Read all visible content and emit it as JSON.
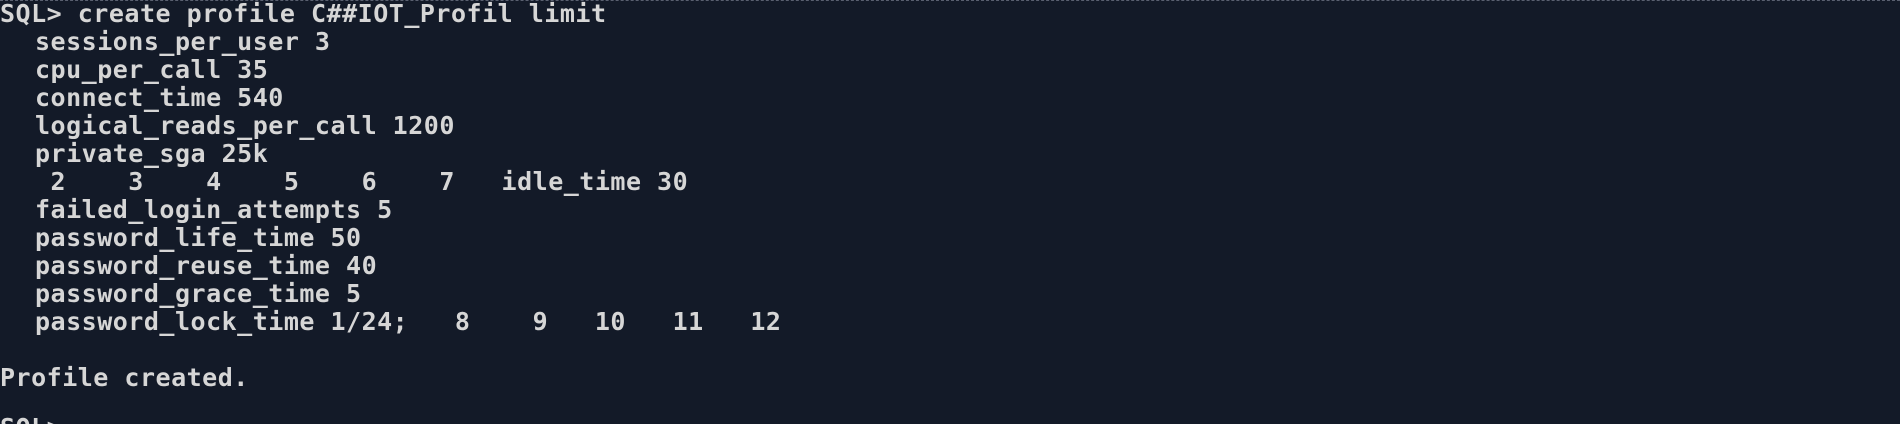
{
  "terminal": {
    "lines": [
      "SQL> create profile C##IOT_Profil limit",
      "sessions_per_user 3",
      "cpu_per_call 35",
      "connect_time 540",
      "logical_reads_per_call 1200",
      "private_sga 25k",
      " 2    3    4    5    6    7   idle_time 30",
      "failed_login_attempts 5",
      "password_life_time 50",
      "password_reuse_time 40",
      "password_grace_time 5",
      "password_lock_time 1/24;   8    9   10   11   12",
      "Profile created.",
      "SQL> "
    ]
  }
}
